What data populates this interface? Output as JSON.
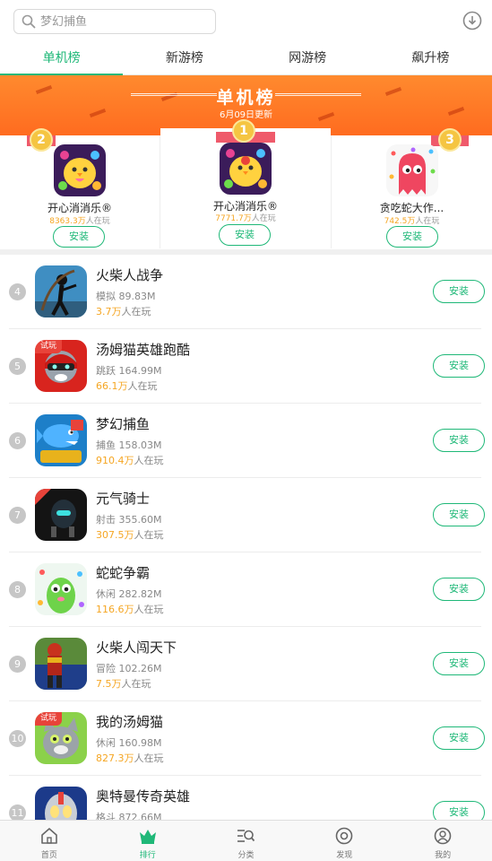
{
  "search": {
    "placeholder": "梦幻捕鱼"
  },
  "icons": {
    "search": "search-icon",
    "download": "download-icon"
  },
  "tabs": [
    {
      "label": "单机榜",
      "active": true
    },
    {
      "label": "新游榜",
      "active": false
    },
    {
      "label": "网游榜",
      "active": false
    },
    {
      "label": "飙升榜",
      "active": false
    }
  ],
  "banner": {
    "title": "单机榜",
    "update": "6月09日更新"
  },
  "podium": [
    {
      "rank": "1",
      "name": "开心消消乐®",
      "players_num": "7771.7万",
      "players_suffix": "人在玩",
      "install": "安装"
    },
    {
      "rank": "2",
      "name": "开心消消乐®",
      "players_num": "8363.3万",
      "players_suffix": "人在玩",
      "install": "安装"
    },
    {
      "rank": "3",
      "name": "贪吃蛇大作...",
      "players_num": "742.5万",
      "players_suffix": "人在玩",
      "install": "安装"
    }
  ],
  "list": [
    {
      "rank": "4",
      "name": "火柴人战争",
      "meta": "模拟 89.83M",
      "players_num": "3.7万",
      "players_suffix": "人在玩",
      "install": "安装",
      "tag": ""
    },
    {
      "rank": "5",
      "name": "汤姆猫英雄跑酷",
      "meta": "跳跃 164.99M",
      "players_num": "66.1万",
      "players_suffix": "人在玩",
      "install": "安装",
      "tag": "试玩"
    },
    {
      "rank": "6",
      "name": "梦幻捕鱼",
      "meta": "捕鱼 158.03M",
      "players_num": "910.4万",
      "players_suffix": "人在玩",
      "install": "安装",
      "tag": ""
    },
    {
      "rank": "7",
      "name": "元气骑士",
      "meta": "射击 355.60M",
      "players_num": "307.5万",
      "players_suffix": "人在玩",
      "install": "安装",
      "tag": ""
    },
    {
      "rank": "8",
      "name": "蛇蛇争霸",
      "meta": "休闲 282.82M",
      "players_num": "116.6万",
      "players_suffix": "人在玩",
      "install": "安装",
      "tag": ""
    },
    {
      "rank": "9",
      "name": "火柴人闯天下",
      "meta": "冒险 102.26M",
      "players_num": "7.5万",
      "players_suffix": "人在玩",
      "install": "安装",
      "tag": ""
    },
    {
      "rank": "10",
      "name": "我的汤姆猫",
      "meta": "休闲 160.98M",
      "players_num": "827.3万",
      "players_suffix": "人在玩",
      "install": "安装",
      "tag": "试玩"
    },
    {
      "rank": "11",
      "name": "奥特曼传奇英雄",
      "meta": "格斗 872.66M",
      "players_num": "",
      "players_suffix": "",
      "install": "安装",
      "tag": ""
    }
  ],
  "nav": [
    {
      "label": "首页",
      "icon": "home-icon",
      "active": false
    },
    {
      "label": "排行",
      "icon": "crown-icon",
      "active": true
    },
    {
      "label": "分类",
      "icon": "category-icon",
      "active": false
    },
    {
      "label": "发现",
      "icon": "discover-icon",
      "active": false
    },
    {
      "label": "我的",
      "icon": "profile-icon",
      "active": false
    }
  ],
  "colors": {
    "accent": "#1fb878",
    "banner": "#ff7a28",
    "highlight": "#f5a623"
  }
}
